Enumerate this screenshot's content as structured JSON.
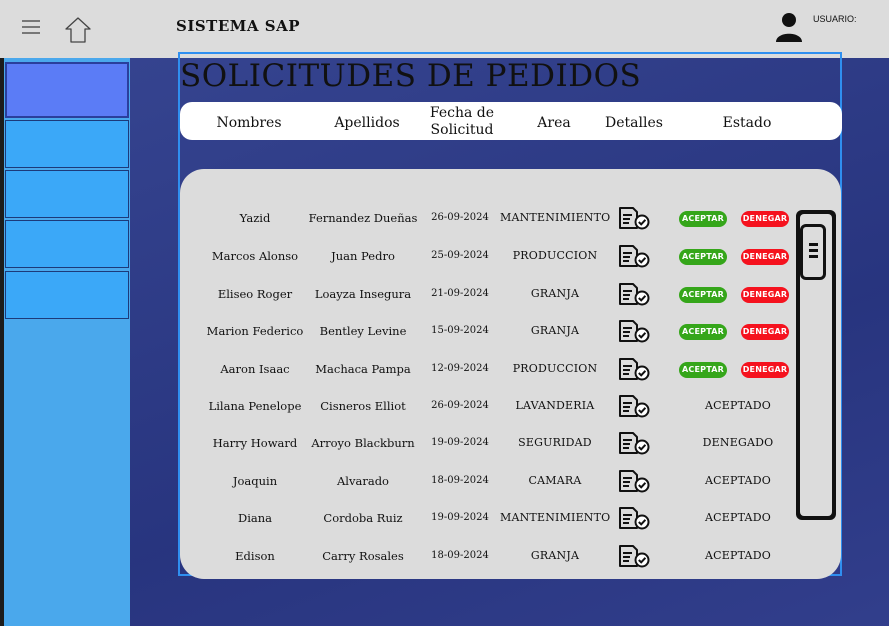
{
  "app": {
    "title": "SISTEMA SAP",
    "user_label": "USUARIO:"
  },
  "page": {
    "title": "SOLICITUDES DE PEDIDOS"
  },
  "columns": [
    "Nombres",
    "Apellidos",
    "Fecha de Solicitud",
    "Area",
    "Detalles",
    "Estado"
  ],
  "actions": {
    "accept_label": "ACEPTAR",
    "deny_label": "DENEGAR"
  },
  "rows": [
    {
      "nombres": "Yazid",
      "apellidos": "Fernandez Dueñas",
      "fecha": "26-09-2024",
      "area": "MANTENIMIENTO",
      "estado": ""
    },
    {
      "nombres": "Marcos Alonso",
      "apellidos": "Juan Pedro",
      "fecha": "25-09-2024",
      "area": "PRODUCCION",
      "estado": ""
    },
    {
      "nombres": "Eliseo Roger",
      "apellidos": "Loayza Insegura",
      "fecha": "21-09-2024",
      "area": "GRANJA",
      "estado": ""
    },
    {
      "nombres": "Marion Federico",
      "apellidos": "Bentley Levine",
      "fecha": "15-09-2024",
      "area": "GRANJA",
      "estado": ""
    },
    {
      "nombres": "Aaron Isaac",
      "apellidos": "Machaca Pampa",
      "fecha": "12-09-2024",
      "area": "PRODUCCION",
      "estado": ""
    },
    {
      "nombres": "Lilana Penelope",
      "apellidos": "Cisneros Elliot",
      "fecha": "26-09-2024",
      "area": "LAVANDERIA",
      "estado": "ACEPTADO"
    },
    {
      "nombres": "Harry Howard",
      "apellidos": "Arroyo Blackburn",
      "fecha": "19-09-2024",
      "area": "SEGURIDAD",
      "estado": "DENEGADO"
    },
    {
      "nombres": "Joaquin",
      "apellidos": "Alvarado",
      "fecha": "18-09-2024",
      "area": "CAMARA",
      "estado": "ACEPTADO"
    },
    {
      "nombres": "Diana",
      "apellidos": "Cordoba Ruiz",
      "fecha": "19-09-2024",
      "area": "MANTENIMIENTO",
      "estado": "ACEPTADO"
    },
    {
      "nombres": "Edison",
      "apellidos": "Carry Rosales",
      "fecha": "18-09-2024",
      "area": "GRANJA",
      "estado": "ACEPTADO"
    }
  ],
  "icons": {
    "menu": "hamburger-menu-icon",
    "home": "home-icon",
    "user": "user-avatar-icon",
    "details": "document-check-icon"
  },
  "colors": {
    "accept": "#35a61a",
    "deny": "#f5121e",
    "frame": "#2f8ff0",
    "sidebar": "#4aa8ec"
  }
}
